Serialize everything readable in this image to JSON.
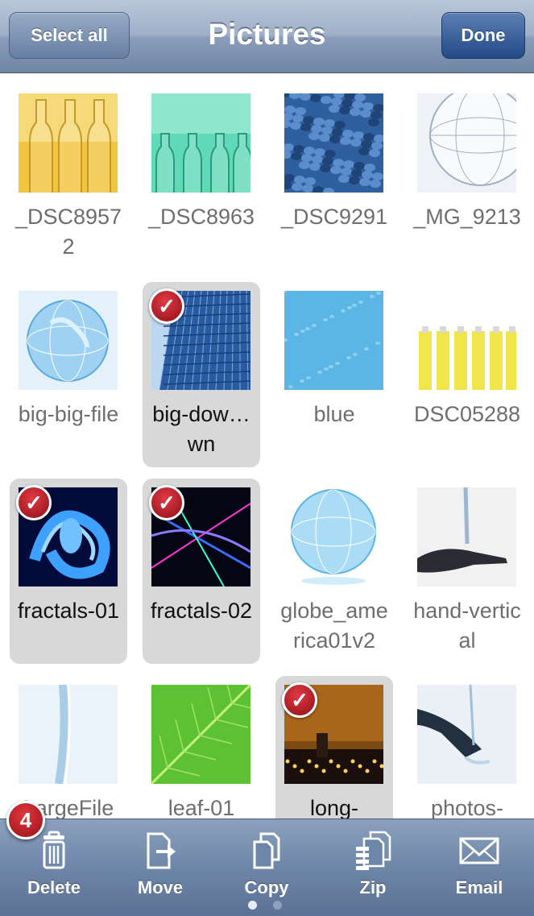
{
  "nav": {
    "title": "Pictures",
    "select_all_label": "Select all",
    "done_label": "Done"
  },
  "items": [
    {
      "label": "_DSC89572",
      "selected": false,
      "thumb": "glass-bottles-yellow"
    },
    {
      "label": "_DSC8963",
      "selected": false,
      "thumb": "glass-bottles-green"
    },
    {
      "label": "_DSC9291",
      "selected": false,
      "thumb": "blue-pebbles"
    },
    {
      "label": "_MG_9213",
      "selected": false,
      "thumb": "wireframe-globe"
    },
    {
      "label": "big-big-file",
      "selected": false,
      "thumb": "glass-globe"
    },
    {
      "label": "big-dow…wn",
      "selected": true,
      "thumb": "skyscraper"
    },
    {
      "label": "blue",
      "selected": false,
      "thumb": "blue-water-drops"
    },
    {
      "label": "DSC05288",
      "selected": false,
      "thumb": "yellow-batteries"
    },
    {
      "label": "fractals-01",
      "selected": true,
      "thumb": "blue-fractal"
    },
    {
      "label": "fractals-02",
      "selected": true,
      "thumb": "fractal-lines"
    },
    {
      "label": "globe_america01v2",
      "selected": false,
      "thumb": "glass-globe-americas"
    },
    {
      "label": "hand-vertical",
      "selected": false,
      "thumb": "hand-water"
    },
    {
      "label": "LargeFile",
      "selected": false,
      "thumb": "water-stream"
    },
    {
      "label": "leaf-01",
      "selected": false,
      "thumb": "green-leaf"
    },
    {
      "label": "long-",
      "selected": true,
      "thumb": "city-night"
    },
    {
      "label": "photos-",
      "selected": false,
      "thumb": "hand-splash"
    }
  ],
  "selection_count": "4",
  "toolbar": {
    "delete_label": "Delete",
    "move_label": "Move",
    "copy_label": "Copy",
    "zip_label": "Zip",
    "email_label": "Email"
  },
  "page_indicator": {
    "count": 2,
    "current": 1
  },
  "colors": {
    "accent_red": "#b3141e",
    "nav_bar": "#8a9dba",
    "selected_bg": "#d8d8d8"
  }
}
